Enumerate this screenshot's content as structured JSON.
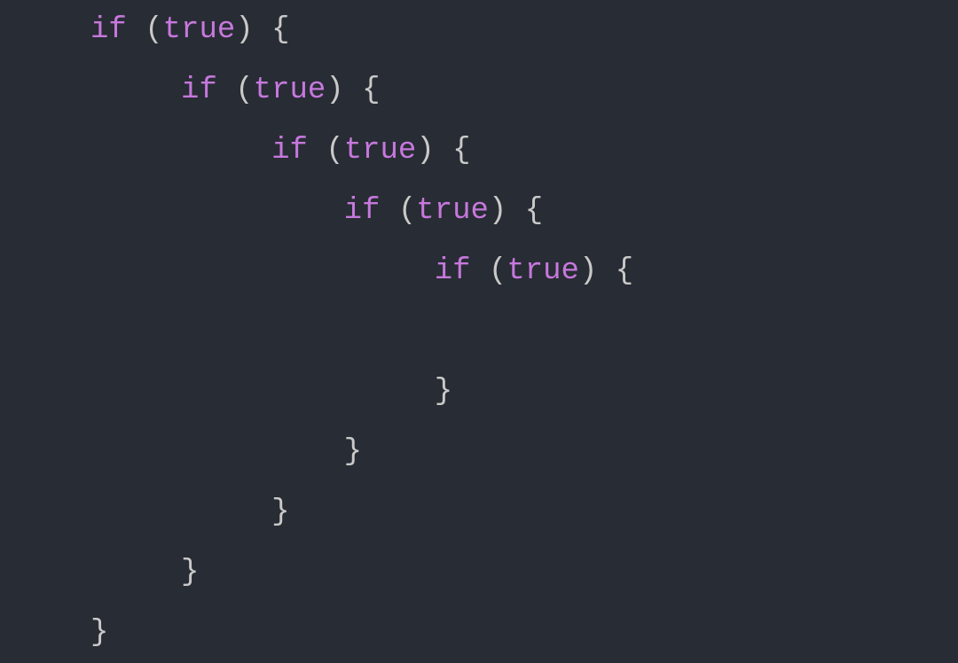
{
  "code": {
    "lines": [
      {
        "indent": "     ",
        "tokens": [
          {
            "type": "keyword",
            "text": "if"
          },
          {
            "type": "plain",
            "text": " "
          },
          {
            "type": "paren",
            "text": "("
          },
          {
            "type": "boolean",
            "text": "true"
          },
          {
            "type": "paren",
            "text": ")"
          },
          {
            "type": "plain",
            "text": " "
          },
          {
            "type": "bracket",
            "text": "{"
          }
        ]
      },
      {
        "indent": "          ",
        "tokens": [
          {
            "type": "keyword",
            "text": "if"
          },
          {
            "type": "plain",
            "text": " "
          },
          {
            "type": "paren",
            "text": "("
          },
          {
            "type": "boolean",
            "text": "true"
          },
          {
            "type": "paren",
            "text": ")"
          },
          {
            "type": "plain",
            "text": " "
          },
          {
            "type": "bracket",
            "text": "{"
          }
        ]
      },
      {
        "indent": "               ",
        "tokens": [
          {
            "type": "keyword",
            "text": "if"
          },
          {
            "type": "plain",
            "text": " "
          },
          {
            "type": "paren",
            "text": "("
          },
          {
            "type": "boolean",
            "text": "true"
          },
          {
            "type": "paren",
            "text": ")"
          },
          {
            "type": "plain",
            "text": " "
          },
          {
            "type": "bracket",
            "text": "{"
          }
        ]
      },
      {
        "indent": "                   ",
        "tokens": [
          {
            "type": "keyword",
            "text": "if"
          },
          {
            "type": "plain",
            "text": " "
          },
          {
            "type": "paren",
            "text": "("
          },
          {
            "type": "boolean",
            "text": "true"
          },
          {
            "type": "paren",
            "text": ")"
          },
          {
            "type": "plain",
            "text": " "
          },
          {
            "type": "bracket",
            "text": "{"
          }
        ]
      },
      {
        "indent": "                        ",
        "tokens": [
          {
            "type": "keyword",
            "text": "if"
          },
          {
            "type": "plain",
            "text": " "
          },
          {
            "type": "paren",
            "text": "("
          },
          {
            "type": "boolean",
            "text": "true"
          },
          {
            "type": "paren",
            "text": ")"
          },
          {
            "type": "plain",
            "text": " "
          },
          {
            "type": "bracket",
            "text": "{"
          }
        ]
      },
      {
        "indent": "",
        "tokens": [
          {
            "type": "plain",
            "text": " "
          }
        ]
      },
      {
        "indent": "                        ",
        "tokens": [
          {
            "type": "bracket",
            "text": "}"
          }
        ]
      },
      {
        "indent": "                   ",
        "tokens": [
          {
            "type": "bracket",
            "text": "}"
          }
        ]
      },
      {
        "indent": "               ",
        "tokens": [
          {
            "type": "bracket",
            "text": "}"
          }
        ]
      },
      {
        "indent": "          ",
        "tokens": [
          {
            "type": "bracket",
            "text": "}"
          }
        ]
      },
      {
        "indent": "     ",
        "tokens": [
          {
            "type": "bracket",
            "text": "}"
          }
        ]
      }
    ]
  }
}
